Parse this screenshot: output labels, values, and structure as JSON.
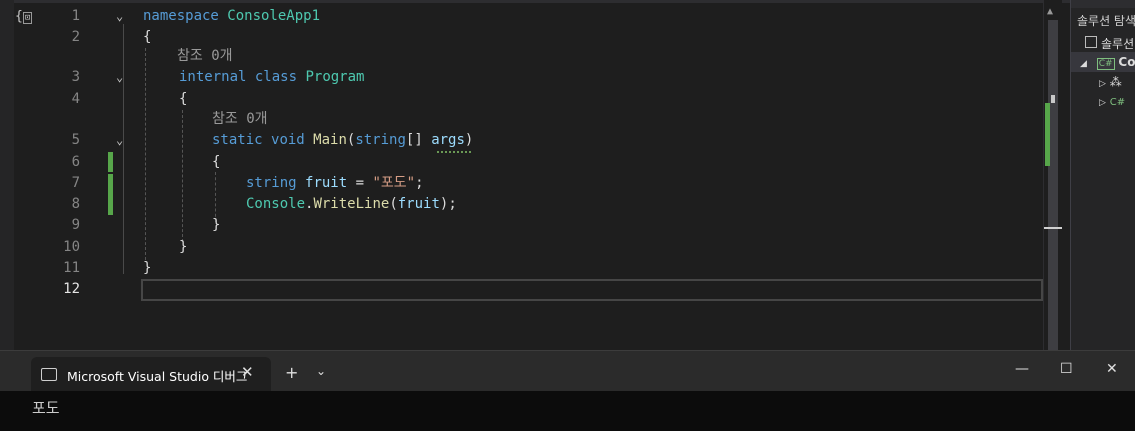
{
  "editor": {
    "lines": [
      {
        "n": "1"
      },
      {
        "n": "2"
      },
      {
        "n": "3"
      },
      {
        "n": "4"
      },
      {
        "n": "5"
      },
      {
        "n": "6"
      },
      {
        "n": "7"
      },
      {
        "n": "8"
      },
      {
        "n": "9"
      },
      {
        "n": "10"
      },
      {
        "n": "11"
      },
      {
        "n": "12"
      }
    ],
    "code": {
      "l1_kw": "namespace",
      "l1_name": " ConsoleApp1",
      "l2": "{",
      "lens1": "참조 0개",
      "l3_kw1": "internal",
      "l3_kw2": "class",
      "l3_type": "Program",
      "l4": "{",
      "lens2": "참조 0개",
      "l5_kw1": "static",
      "l5_kw2": "void",
      "l5_fn": "Main",
      "l5_open": "(",
      "l5_kw3": "string",
      "l5_mid": "[] ",
      "l5_arg": "args",
      "l5_close": ")",
      "l6": "{",
      "l7_kw": "string",
      "l7_var": "fruit",
      "l7_eq": " = ",
      "l7_str": "\"포도\"",
      "l7_semi": ";",
      "l8_type": "Console",
      "l8_dot": ".",
      "l8_fn": "WriteLine",
      "l8_open": "(",
      "l8_arg": "fruit",
      "l8_close": ");",
      "l9": "}",
      "l10": "}",
      "l11": "}"
    }
  },
  "solution_explorer": {
    "title": "솔루션 탐색",
    "root": "솔루션",
    "project": "Co",
    "child1": "⁂",
    "child2": "C#"
  },
  "terminal": {
    "tab_title": "Microsoft Visual Studio 디버그",
    "close_glyph": "✕",
    "new_tab_glyph": "+",
    "dropdown_glyph": "⌄",
    "minimize_glyph": "—",
    "maximize_glyph": "☐",
    "window_close_glyph": "✕",
    "output": "포도"
  },
  "colors": {
    "keyword": "#569cd6",
    "type": "#4ec9b0",
    "method": "#dcdcaa",
    "string": "#d69d85",
    "variable": "#9cdcfe",
    "change_bar": "#57a64a"
  }
}
